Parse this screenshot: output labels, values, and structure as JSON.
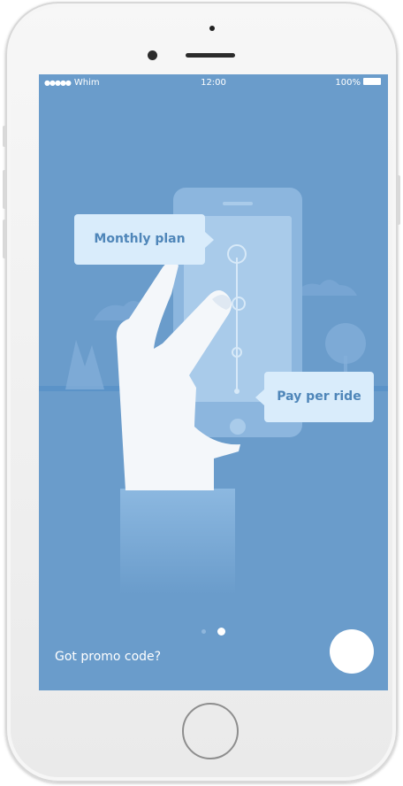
{
  "status_bar": {
    "carrier_dots": "●●●●●",
    "carrier": "Whim",
    "time": "12:00",
    "battery": "100%"
  },
  "onboarding": {
    "bubble_monthly": "Monthly plan",
    "bubble_pay_per_ride": "Pay per ride",
    "page_count": 2,
    "current_page": 2
  },
  "footer": {
    "promo_label": "Got promo code?"
  },
  "colors": {
    "screen_background": "#6a9ccb",
    "bubble_background": "#d9ecfb",
    "bubble_text": "#4f86b9",
    "hand": "#f4f7fa",
    "sleeve": "#8cb8e0"
  },
  "icons": {
    "next": "circle-button",
    "home": "home-button-ring"
  }
}
